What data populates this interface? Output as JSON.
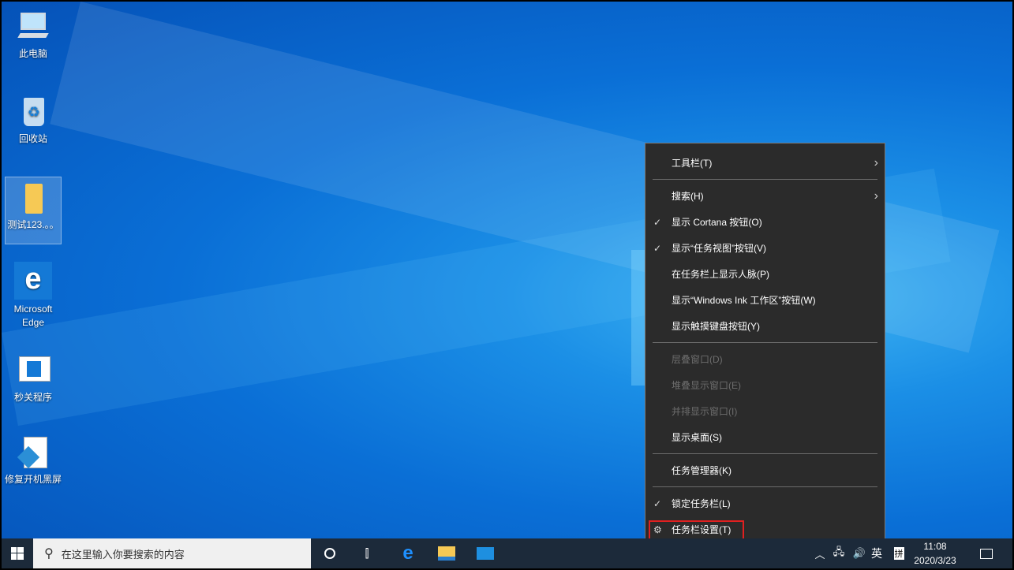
{
  "desktop": {
    "icons": [
      {
        "label": "此电脑",
        "icon": "computer-icon"
      },
      {
        "label": "回收站",
        "icon": "recycle-bin-icon"
      },
      {
        "label": "测试123.。。",
        "icon": "folder-icon"
      },
      {
        "label": "Microsoft Edge",
        "icon": "edge-icon"
      },
      {
        "label": "秒关程序",
        "icon": "program-shortcut-icon"
      },
      {
        "label": "修复开机黑屏",
        "icon": "repair-script-icon"
      }
    ]
  },
  "context_menu": {
    "items": [
      {
        "label": "工具栏(T)",
        "submenu": true
      },
      {
        "label": "搜索(H)",
        "submenu": true
      },
      {
        "label": "显示 Cortana 按钮(O)",
        "checked": true
      },
      {
        "label": "显示“任务视图”按钮(V)",
        "checked": true
      },
      {
        "label": "在任务栏上显示人脉(P)"
      },
      {
        "label": "显示“Windows Ink 工作区”按钮(W)"
      },
      {
        "label": "显示触摸键盘按钮(Y)"
      },
      {
        "label": "层叠窗口(D)",
        "disabled": true
      },
      {
        "label": "堆叠显示窗口(E)",
        "disabled": true
      },
      {
        "label": "并排显示窗口(I)",
        "disabled": true
      },
      {
        "label": "显示桌面(S)"
      },
      {
        "label": "任务管理器(K)"
      },
      {
        "label": "锁定任务栏(L)",
        "checked": true
      },
      {
        "label": "任务栏设置(T)",
        "icon": "gear-icon",
        "highlighted": true
      }
    ]
  },
  "taskbar": {
    "search_placeholder": "在这里输入你要搜索的内容",
    "ime_lang": "英",
    "ime_mode": "拼",
    "time": "11:08",
    "date": "2020/3/23"
  },
  "colors": {
    "highlight": "#e02020",
    "menu_bg": "#2b2b2b",
    "taskbar": "#1c2a3a"
  }
}
